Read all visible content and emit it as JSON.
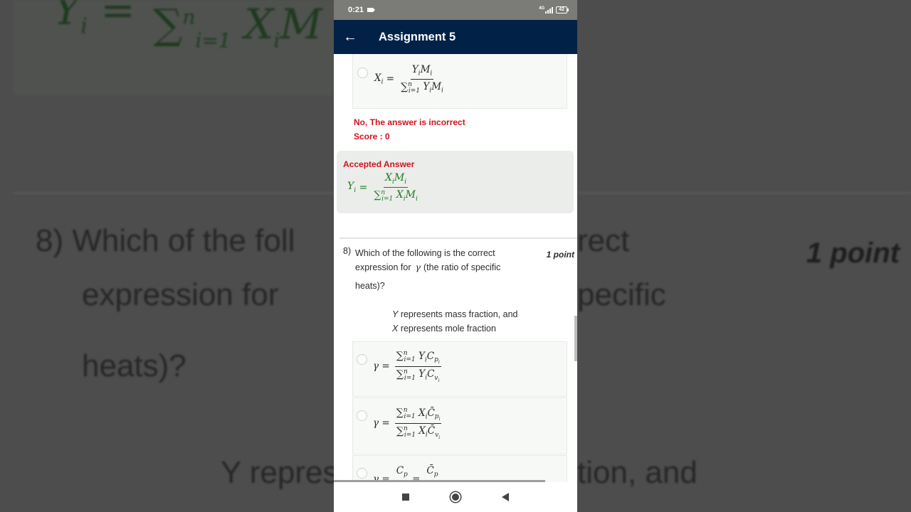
{
  "status_bar": {
    "time": "0:21",
    "network": "4G",
    "battery": "42"
  },
  "app_bar": {
    "title": "Assignment 5",
    "back_icon": "arrow-left-icon"
  },
  "previous_question": {
    "selected_option": {
      "lhs": "X",
      "lhs_sub": "i",
      "numerator": "Y_i M_i",
      "denominator": "∑_{i=1}^{n} Y_i M_i"
    },
    "feedback": "No, The answer is incorrect",
    "score": "Score : 0",
    "accepted_answer_label": "Accepted Answer",
    "accepted_answer": {
      "lhs": "Y",
      "lhs_sub": "i",
      "numerator": "X_i M_i",
      "denominator": "∑_{i=1}^{n} X_i M_i"
    }
  },
  "question": {
    "number": "8)",
    "text_line1": "Which of the following is the correct",
    "text_line2_pre": "expression for",
    "symbol": "γ",
    "text_line2_post": "(the ratio of specific",
    "text_line3": "heats)?",
    "points": "1 point",
    "note_line1_var": "Y",
    "note_line1": " represents mass fraction, and",
    "note_line2_var": "X",
    "note_line2": " represents mole fraction",
    "options": [
      {
        "lhs": "γ",
        "numerator": "∑_{i=1}^{n} Y_i C_{p_i}",
        "denominator": "∑_{i=1}^{n} Y_i C_{v_i}"
      },
      {
        "lhs": "γ",
        "numerator": "∑_{i=1}^{n} X_i C̄_{p_i}",
        "denominator": "∑_{i=1}^{n} X_i C̄_{v_i}"
      },
      {
        "lhs": "γ",
        "numerator": "C_p",
        "denominator": "C̄_p"
      }
    ]
  },
  "nav_bar": {
    "recents_icon": "square-icon",
    "home_icon": "circle-icon",
    "back_icon": "triangle-back-icon"
  },
  "backdrop": {
    "question_fragment_1": "8)  Which of the foll",
    "question_fragment_2": "expression for",
    "question_fragment_3": "heats)?",
    "right_fragment_1": "rect",
    "right_fragment_2": "pecific",
    "points": "1 point",
    "note_fragment_left": "Y repres",
    "note_fragment_right": "tion, and"
  }
}
